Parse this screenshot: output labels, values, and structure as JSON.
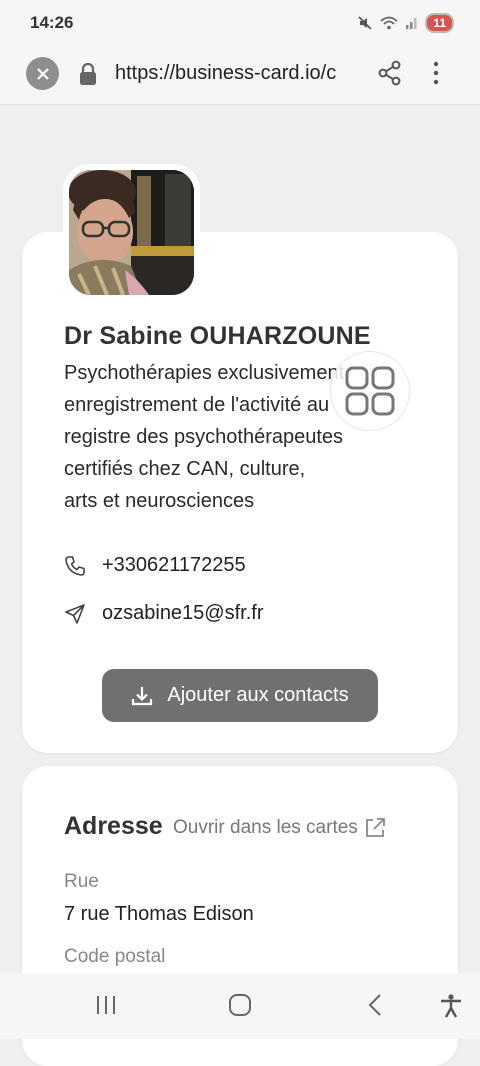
{
  "status": {
    "time": "14:26",
    "battery": "11"
  },
  "browser": {
    "url": "https://business-card.io/c"
  },
  "profile": {
    "name": "Dr Sabine OUHARZOUNE",
    "bio_lines": [
      "Psychothérapies exclusivement,",
      "enregistrement de l'activité au",
      "registre des psychothérapeutes",
      "certifiés chez CAN, culture,",
      "arts et neurosciences"
    ],
    "phone": "+330621172255",
    "email": "ozsabine15@sfr.fr",
    "add_contact_label": "Ajouter aux contacts"
  },
  "address": {
    "title": "Adresse",
    "open_maps_label": "Ouvrir dans les cartes",
    "street_label": "Rue",
    "street_value": "7 rue Thomas Edison",
    "postal_label": "Code postal"
  },
  "icons": {
    "close": "close-icon",
    "lock": "lock-icon",
    "share": "share-icon",
    "menu": "more-vert-icon",
    "phone": "phone-icon",
    "email": "send-icon",
    "download": "download-icon",
    "external": "external-link-icon",
    "qr": "qr-code-icon"
  },
  "colors": {
    "button_bg": "#707070",
    "background": "#efefef",
    "battery": "#d9534f"
  }
}
